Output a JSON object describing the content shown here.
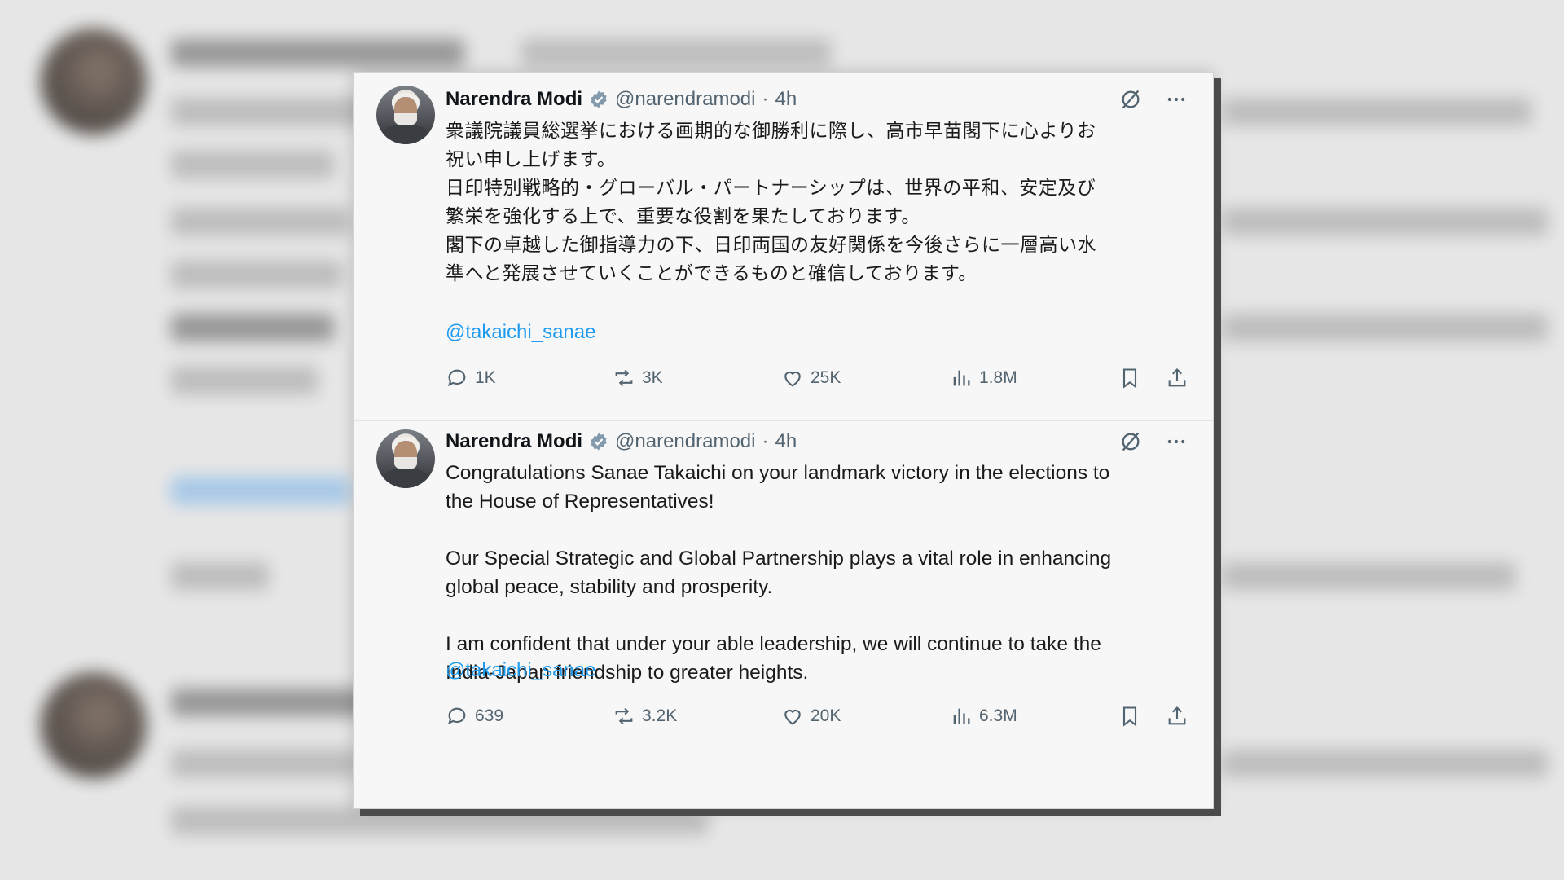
{
  "background": {
    "color": "#e6e6e6"
  },
  "posts": [
    {
      "author": {
        "name": "Narendra Modi",
        "handle": "@narendramodi",
        "separator": "·",
        "time": "4h",
        "verified_color": "#829aab"
      },
      "text": "衆議院議員総選挙における画期的な御勝利に際し、高市早苗閣下に心よりお\n祝い申し上げます。\n日印特別戦略的・グローバル・パートナーシップは、世界の平和、安定及び\n繁栄を強化する上で、重要な役割を果たしております。\n閣下の卓越した御指導力の下、日印両国の友好関係を今後さらに一層高い水\n準へと発展させていくことができるものと確信しております。",
      "mention": "@takaichi_sanae",
      "stats": {
        "replies": "1K",
        "reposts": "3K",
        "likes": "25K",
        "views": "1.8M"
      }
    },
    {
      "author": {
        "name": "Narendra Modi",
        "handle": "@narendramodi",
        "separator": "·",
        "time": "4h",
        "verified_color": "#829aab"
      },
      "text": "Congratulations Sanae Takaichi on your landmark victory in the elections to\nthe House of Representatives!\n\nOur Special Strategic and Global Partnership plays a vital role in enhancing\nglobal peace, stability and prosperity.\n\nI am confident that under your able leadership, we will continue to take the\nIndia-Japan friendship to greater heights.",
      "mention": "@takaichi_sanae",
      "stats": {
        "replies": "639",
        "reposts": "3.2K",
        "likes": "20K",
        "views": "6.3M"
      }
    }
  ],
  "colors": {
    "link": "#1d9bf0",
    "muted": "#536471",
    "text": "#0f1419"
  }
}
